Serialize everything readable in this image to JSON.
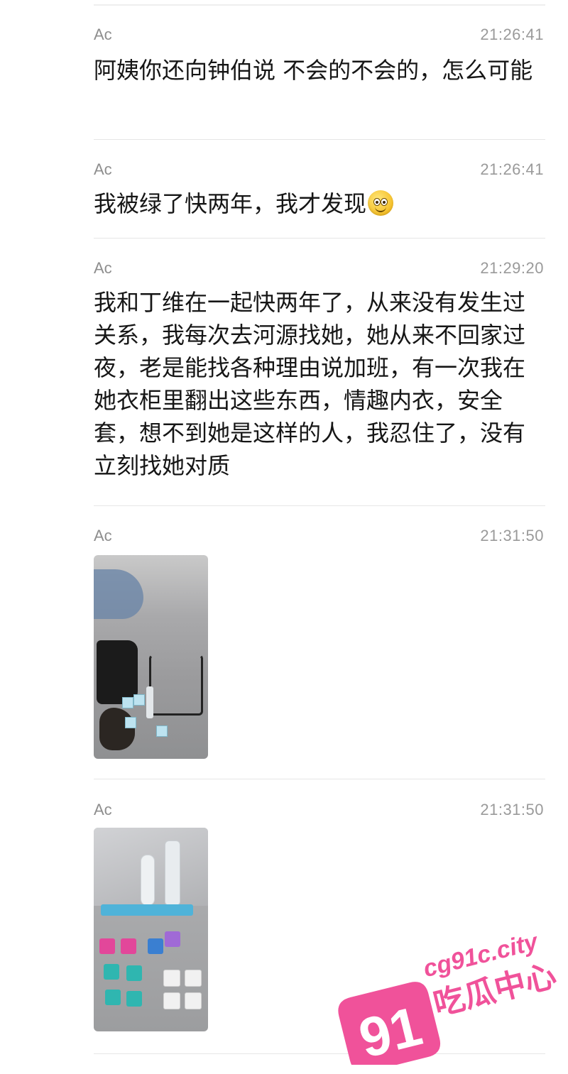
{
  "messages": [
    {
      "sender": "Ac",
      "time": "21:26:41",
      "text": "阿姨你还向钟伯说 不会的不会的，怎么可能"
    },
    {
      "sender": "Ac",
      "time": "21:26:41",
      "text": "我被绿了快两年，我才发现",
      "emoji": "smiling-face-icon"
    },
    {
      "sender": "Ac",
      "time": "21:29:20",
      "text": "我和丁维在一起快两年了，从来没有发生过关系，我每次去河源找她，她从来不回家过夜，老是能找各种理由说加班，有一次我在她衣柜里翻出这些东西，情趣内衣，安全套，想不到她是这样的人，我忍住了，没有立刻找她对质"
    },
    {
      "sender": "Ac",
      "time": "21:31:50",
      "image": "photo-bedding-lingerie"
    },
    {
      "sender": "Ac",
      "time": "21:31:50",
      "image": "photo-bedding-condoms"
    }
  ],
  "watermark": {
    "number": "91",
    "domain": "cg91c.city",
    "label": "吃瓜中心",
    "color": "#f0529a"
  }
}
